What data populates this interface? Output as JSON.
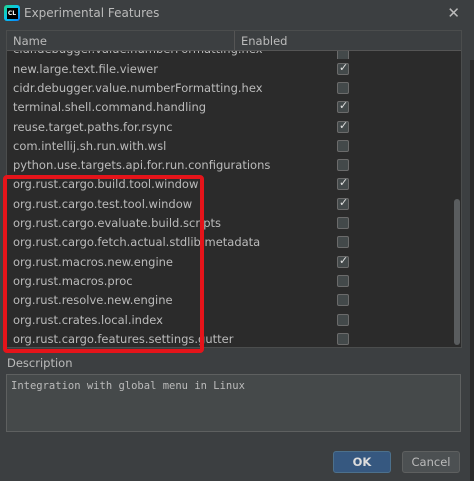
{
  "window": {
    "title": "Experimental Features",
    "app_icon": "CL",
    "close_glyph": "✕"
  },
  "table": {
    "columns": {
      "name": "Name",
      "enabled": "Enabled"
    },
    "rows": [
      {
        "name": "cidr.debugger.value.numberFormatting.hex",
        "enabled": false
      },
      {
        "name": "new.large.text.file.viewer",
        "enabled": true
      },
      {
        "name": "cidr.debugger.value.numberFormatting.hex",
        "enabled": false
      },
      {
        "name": "terminal.shell.command.handling",
        "enabled": true
      },
      {
        "name": "reuse.target.paths.for.rsync",
        "enabled": true
      },
      {
        "name": "com.intellij.sh.run.with.wsl",
        "enabled": false
      },
      {
        "name": "python.use.targets.api.for.run.configurations",
        "enabled": false
      },
      {
        "name": "org.rust.cargo.build.tool.window",
        "enabled": true
      },
      {
        "name": "org.rust.cargo.test.tool.window",
        "enabled": true
      },
      {
        "name": "org.rust.cargo.evaluate.build.scripts",
        "enabled": false
      },
      {
        "name": "org.rust.cargo.fetch.actual.stdlib.metadata",
        "enabled": false
      },
      {
        "name": "org.rust.macros.new.engine",
        "enabled": true
      },
      {
        "name": "org.rust.macros.proc",
        "enabled": false
      },
      {
        "name": "org.rust.resolve.new.engine",
        "enabled": false
      },
      {
        "name": "org.rust.crates.local.index",
        "enabled": false
      },
      {
        "name": "org.rust.cargo.features.settings.gutter",
        "enabled": false
      }
    ]
  },
  "description": {
    "label": "Description",
    "text": "Integration with global menu in Linux"
  },
  "buttons": {
    "ok": "OK",
    "cancel": "Cancel"
  },
  "colors": {
    "highlight": "#e5141a",
    "ok_button": "#365880"
  }
}
